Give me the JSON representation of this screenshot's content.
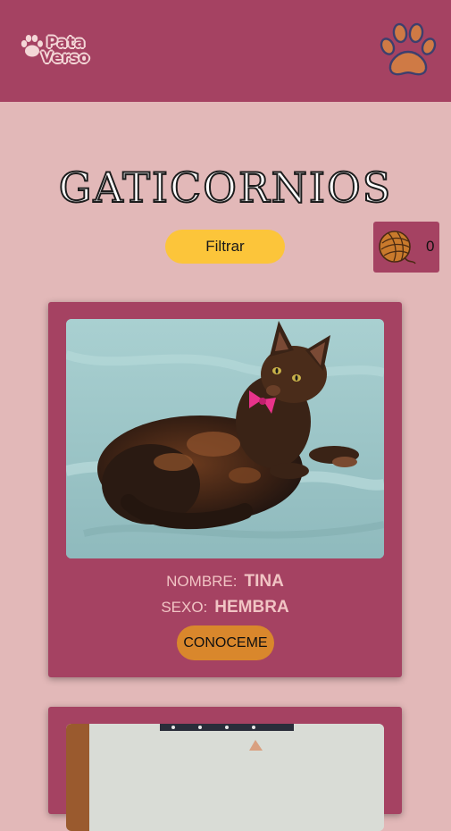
{
  "header": {
    "logo_line1": "Pata",
    "logo_line2": "Verso",
    "paw_icon": "paw-icon"
  },
  "page": {
    "title": "GATICORNIOS"
  },
  "toolbar": {
    "filter_label": "Filtrar",
    "cart_icon": "yarn-ball-icon",
    "cart_count": "0"
  },
  "cards": [
    {
      "name_label": "NOMBRE:",
      "name_value": "TINA",
      "sex_label": "SEXO:",
      "sex_value": "HEMBRA",
      "button_label": "CONOCEME"
    }
  ],
  "colors": {
    "background": "#e2b8b8",
    "brand": "#a54262",
    "filter_button": "#fcc53a",
    "meet_button": "#d9872c"
  }
}
